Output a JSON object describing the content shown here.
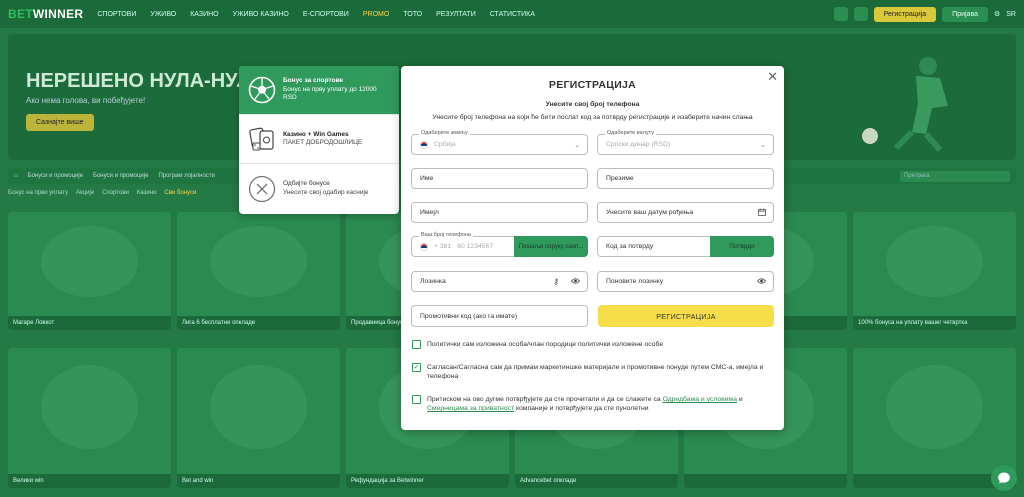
{
  "topbar": {
    "logo_a": "BET",
    "logo_b": "WINNER",
    "nav": [
      "Спортови",
      "Уживо",
      "Казино",
      "Уживо казино",
      "Е-спортови",
      "Promo",
      "Тото",
      "Резултати",
      "Статистика"
    ],
    "register_label": "Регистрација",
    "login_label": "Пријава",
    "lang": "SR"
  },
  "hero": {
    "title": "НЕРЕШЕНО НУЛА-НУЛА",
    "subtitle": "Ако нема голова, ви побеђујете!",
    "button": "Сазнајте више"
  },
  "background": {
    "search_placeholder": "Претрага",
    "filters": [
      "Бонуси и промоције",
      "Бонуси и промоције",
      "Програм лојалности"
    ],
    "subfilters": [
      "Бонус на први уплату",
      "Акције",
      "Спортови",
      "Казино",
      "Сви бонуси"
    ],
    "cards_row1": [
      "Магаре Ловкот",
      "Лига 6 бесплатне опкладе",
      "Продавница бонуса",
      "",
      "",
      "100% бонуса на уплату вашег четвртка"
    ],
    "cards_row2": [
      "Велики win",
      "Bet and win",
      "Рефундација за Betwinner",
      "Advancebet опкладе",
      "",
      ""
    ]
  },
  "bonus_panel": {
    "options": [
      {
        "title": "Бонус за спортове",
        "text": "Бонус на прву уплату до 12000 RSD",
        "icon": "soccer-ball-icon"
      },
      {
        "title": "Казино + Win Games",
        "text": "ПАКЕТ ДОБРОДОШЛИЦЕ",
        "icon": "casino-cards-icon"
      },
      {
        "title": "Одбијте бонусе",
        "text": "Унесите свој одабир касније",
        "icon": "decline-x-icon"
      }
    ]
  },
  "modal": {
    "title": "РЕГИСТРАЦИЈА",
    "subtitle": "Унесите свој број телефона",
    "description": "Унесите број телефона на који ће бити послат код за потврду регистрације и изаберите начин слања",
    "country": {
      "label": "Одаберите земљу",
      "value": "Србија"
    },
    "currency": {
      "label": "Одаберите валуту",
      "value": "Српски динар (RSD)"
    },
    "first_name": "Име",
    "last_name": "Презиме",
    "email": "Имејл",
    "birthdate": "Унесите ваш датум рођења",
    "phone": {
      "label": "Ваш број телефона",
      "prefix": "+ 381",
      "placeholder": "60 1234567",
      "send_button": "Пошаљи поруку саоп..."
    },
    "confirm_code": {
      "placeholder": "Код за потврду",
      "button": "Потврди"
    },
    "password": "Лозинка",
    "repeat_password": "Поновите лозинку",
    "promo": "Промотивни код (ако га имате)",
    "register_button": "РЕГИСТРАЦИЈА",
    "check1": "Политички сам изложена особа/члан породице политички изложене особе",
    "check2": "Сагласан/Сагласна сам да примам маркетиншке материјале и промотивне понуде путем СМС-а, имејла и телефона",
    "check3_a": "Притиском на ово дугме потврђујете да сте прочитали и да се слажете са ",
    "check3_link1": "Одредбама и условима",
    "check3_b": " и ",
    "check3_link2": "Смерницама за приватност",
    "check3_c": " компаније и потврђујете да сте пунолетни",
    "check_states": [
      false,
      true,
      false
    ]
  },
  "colors": {
    "accent": "#2f9a5c",
    "cta": "#f7dd4a",
    "backdrop": "#1f6b3c"
  }
}
